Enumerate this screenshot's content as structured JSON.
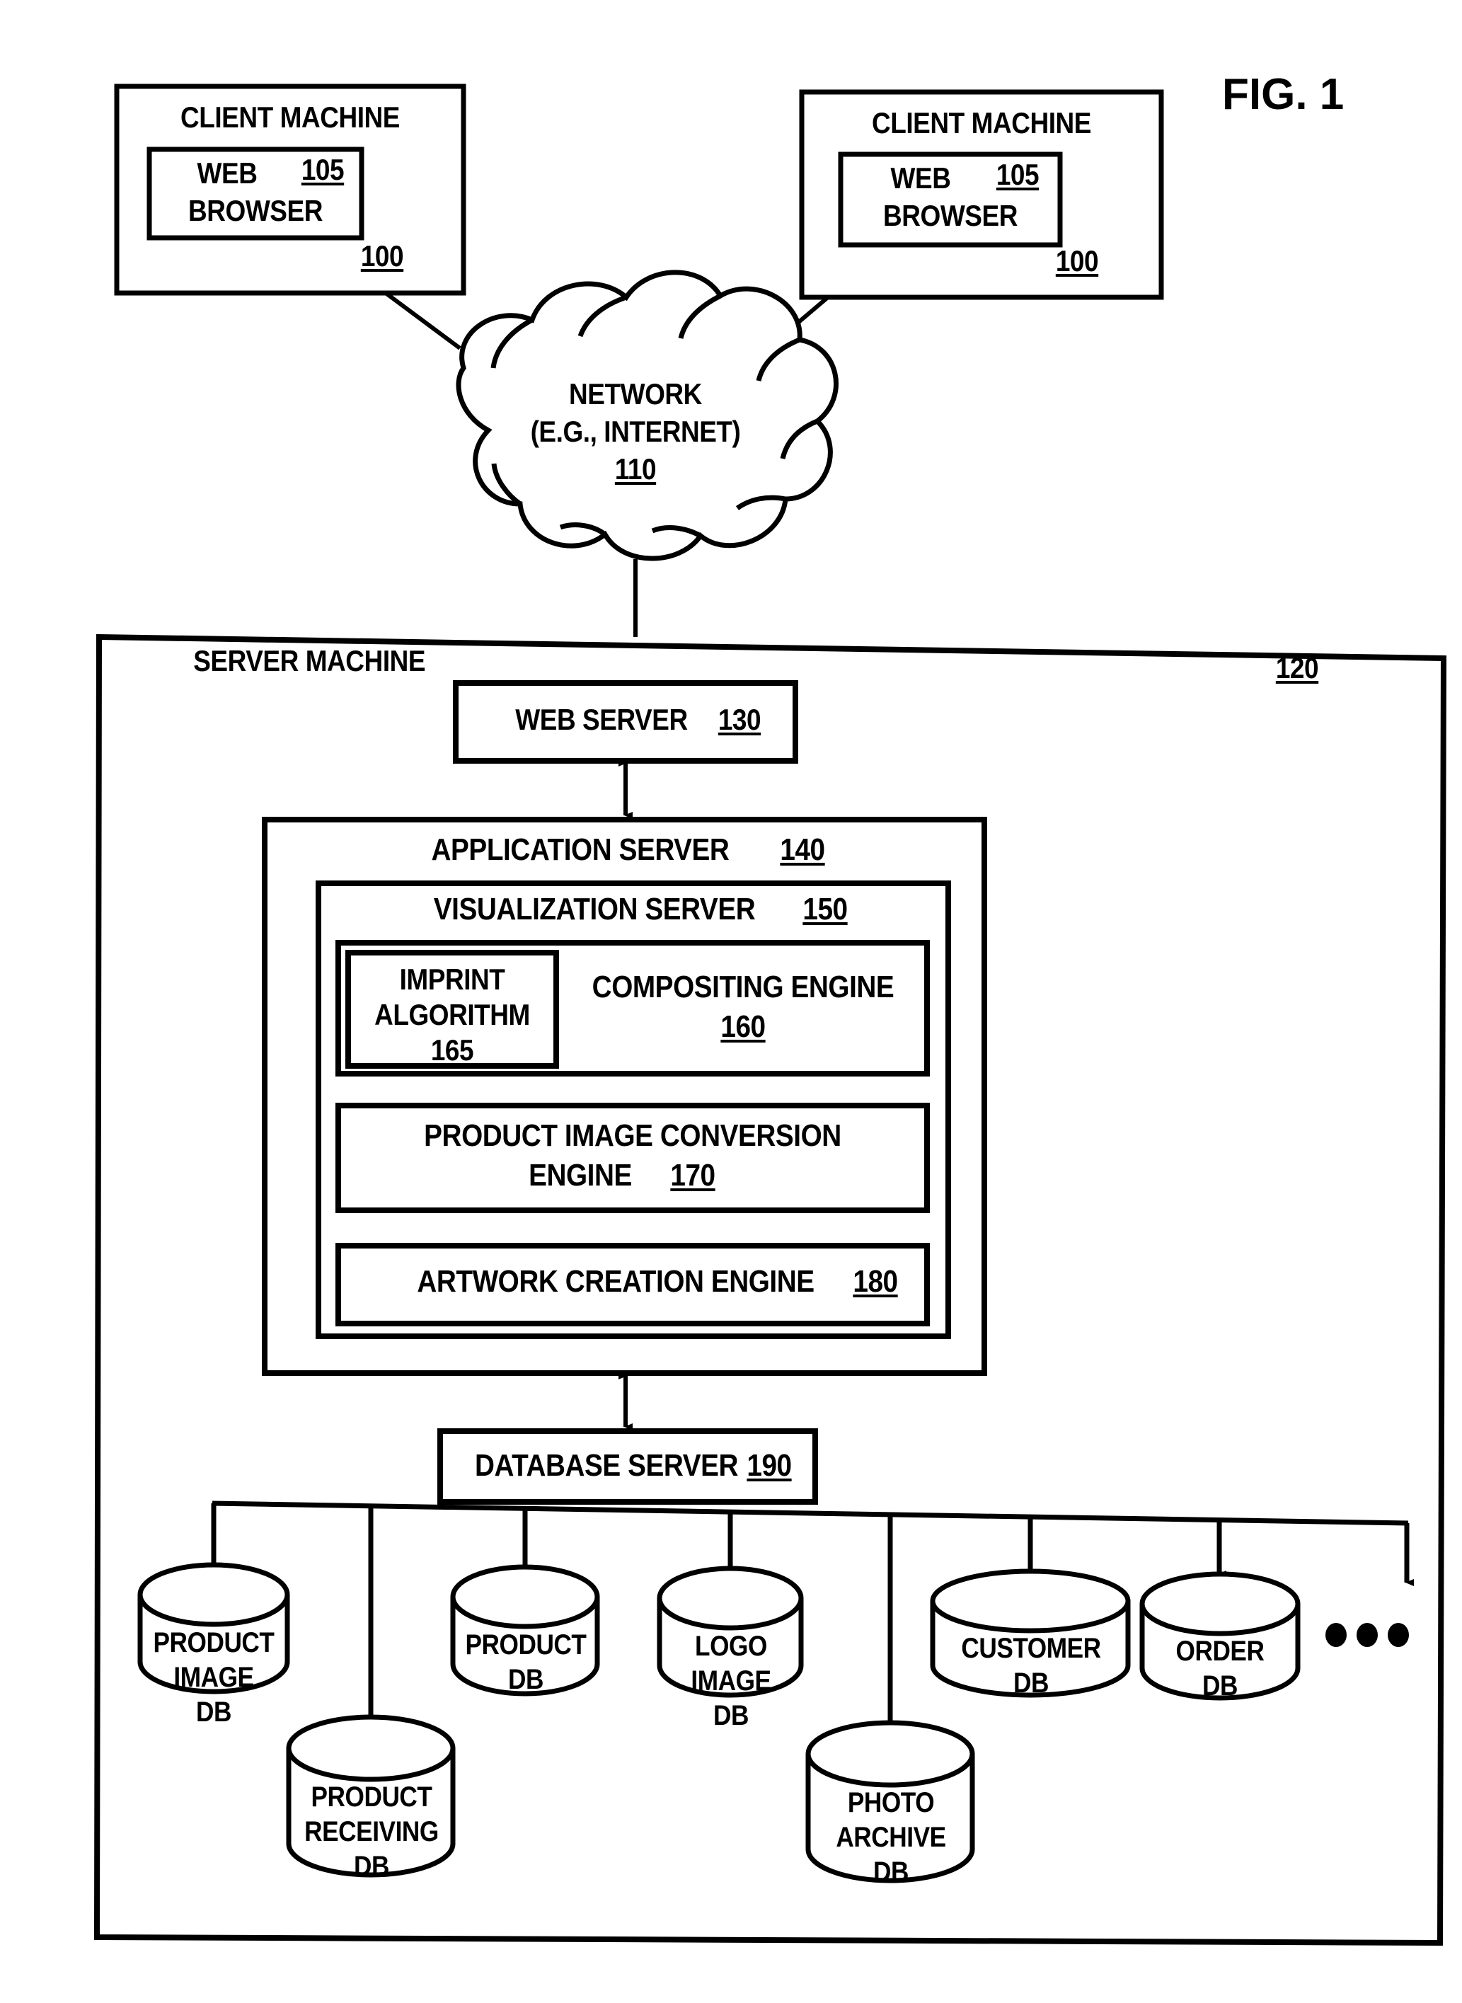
{
  "figure": {
    "title": "FIG. 1"
  },
  "clients": [
    {
      "title": "CLIENT MACHINE",
      "ref": "100",
      "inner": {
        "line1": "WEB",
        "line2": "BROWSER",
        "ref": "105"
      }
    },
    {
      "title": "CLIENT MACHINE",
      "ref": "100",
      "inner": {
        "line1": "WEB",
        "line2": "BROWSER",
        "ref": "105"
      }
    }
  ],
  "network": {
    "line1": "NETWORK",
    "line2": "(E.G., INTERNET)",
    "ref": "110"
  },
  "server_machine": {
    "title": "SERVER MACHINE",
    "ref": "120",
    "web_server": {
      "label": "WEB SERVER",
      "ref": "130"
    },
    "application_server": {
      "label": "APPLICATION SERVER",
      "ref": "140",
      "visualization_server": {
        "label": "VISUALIZATION SERVER",
        "ref": "150",
        "compositing_engine": {
          "label": "COMPOSITING ENGINE",
          "ref": "160",
          "imprint_algorithm": {
            "line1": "IMPRINT",
            "line2": "ALGORITHM",
            "ref": "165"
          }
        },
        "product_image_conversion_engine": {
          "line1": "PRODUCT IMAGE CONVERSION",
          "line2": "ENGINE",
          "ref": "170"
        },
        "artwork_creation_engine": {
          "label": "ARTWORK CREATION ENGINE",
          "ref": "180"
        }
      }
    },
    "database_server": {
      "label": "DATABASE SERVER",
      "ref": "190"
    },
    "databases": [
      {
        "lines": [
          "PRODUCT",
          "IMAGE",
          "DB"
        ]
      },
      {
        "lines": [
          "PRODUCT",
          "DB"
        ]
      },
      {
        "lines": [
          "LOGO",
          "IMAGE",
          "DB"
        ]
      },
      {
        "lines": [
          "CUSTOMER",
          "DB"
        ]
      },
      {
        "lines": [
          "ORDER",
          "DB"
        ]
      },
      {
        "lines": [
          "PRODUCT",
          "RECEIVING",
          "DB"
        ]
      },
      {
        "lines": [
          "PHOTO",
          "ARCHIVE",
          "DB"
        ]
      }
    ],
    "ellipsis": "•••"
  }
}
